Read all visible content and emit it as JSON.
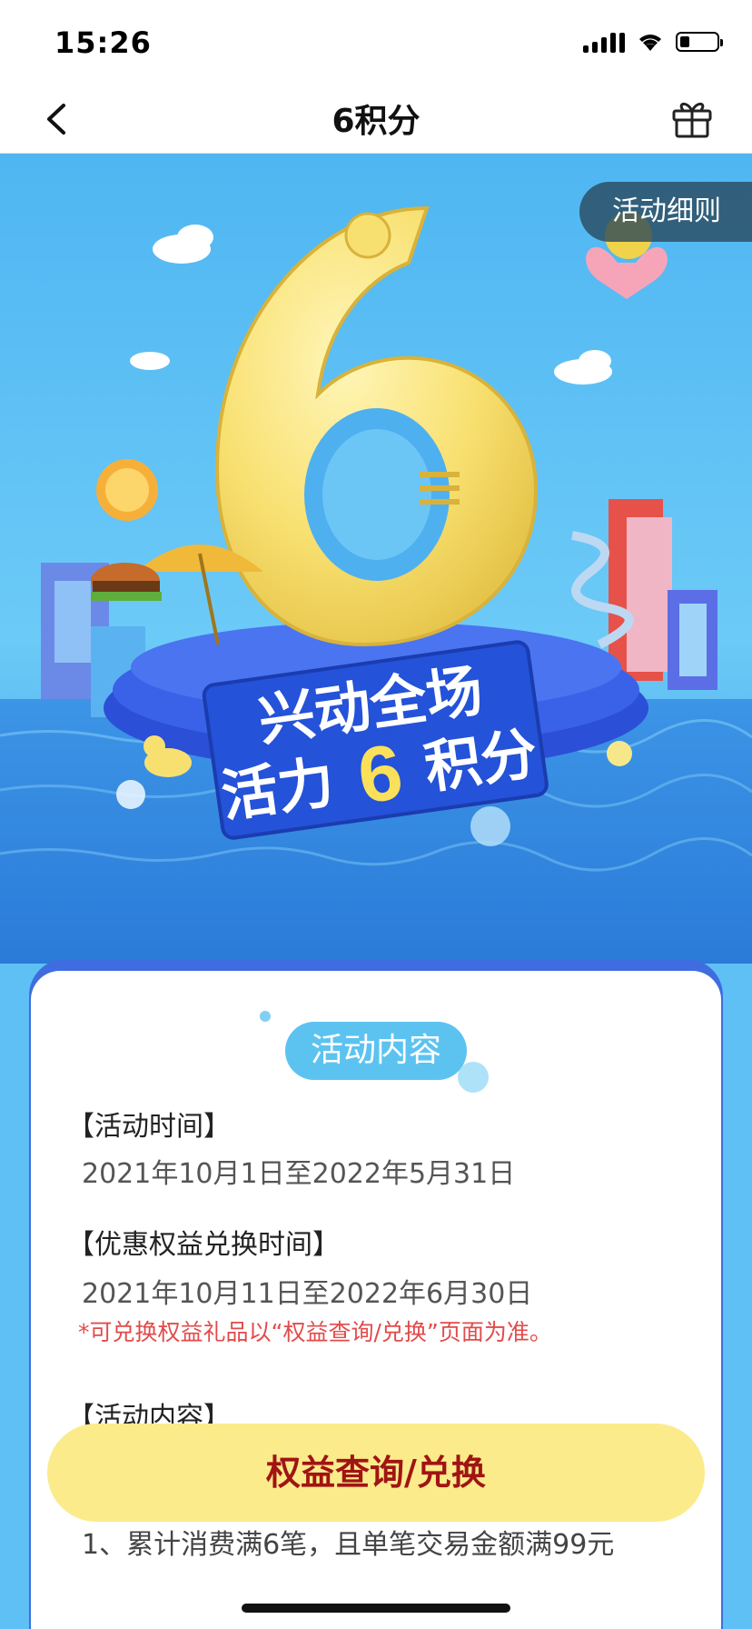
{
  "status_bar": {
    "time": "15:26"
  },
  "nav": {
    "title": "6积分",
    "back_icon": "chevron-left-icon",
    "gift_icon": "gift-icon"
  },
  "banner": {
    "rules_button_label": "活动细则",
    "headline_line1": "兴动全场",
    "headline_line2_pre": "活力",
    "headline_big_digit": "6",
    "headline_line2_post": "积分",
    "hero_digit": "6"
  },
  "card": {
    "tag_label": "活动内容",
    "sections": [
      {
        "title": "【活动时间】",
        "value": "2021年10月1日至2022年5月31日"
      },
      {
        "title": "【优惠权益兑换时间】",
        "value": "2021年10月11日至2022年6月30日",
        "note": "*可兑换权益礼品以“权益查询/兑换”页面为准。"
      },
      {
        "title": "【活动内容】"
      }
    ],
    "step_1": "1、累计消费满6笔，且单笔交易金额满99元"
  },
  "cta": {
    "label": "权益查询/兑换"
  },
  "colors": {
    "sky": "#5ec0f5",
    "card_border": "#3f6de0",
    "tag_bg": "#5cc3f0",
    "cta_bg": "#fbeb8b",
    "cta_text": "#a01414",
    "note_text": "#e24b4b"
  }
}
